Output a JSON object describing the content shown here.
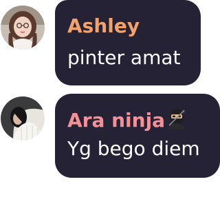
{
  "messages": [
    {
      "sender": "Ashley",
      "text": "pinter amat",
      "avatar_icon": "user-avatar-woman-glasses",
      "name_color": "#f2a26a"
    },
    {
      "sender": "Ara ninja",
      "sender_emoji_icon": "ninja-icon",
      "text": "Yg bego diem",
      "avatar_icon": "user-avatar-dark-hair",
      "name_color": "#f59196"
    }
  ],
  "colors": {
    "bubble_background": "#262235",
    "message_text": "#ffffff",
    "page_background": "#ffffff"
  }
}
